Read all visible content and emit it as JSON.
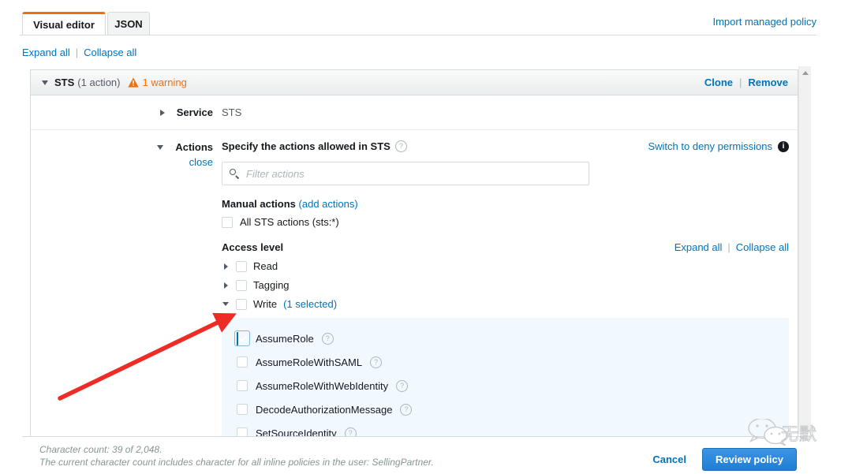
{
  "tabs": {
    "visual_editor": "Visual editor",
    "json": "JSON"
  },
  "header": {
    "import_link": "Import managed policy",
    "expand_all": "Expand all",
    "collapse_all": "Collapse all",
    "separator": "|"
  },
  "card": {
    "title": "STS",
    "count": "(1 action)",
    "warning_icon": "warning-triangle-icon",
    "warning_text": "1 warning",
    "clone": "Clone",
    "remove": "Remove",
    "separator": "|"
  },
  "service": {
    "label": "Service",
    "value": "STS"
  },
  "actions": {
    "label": "Actions",
    "close_link": "close",
    "title": "Specify the actions allowed in STS",
    "help_icon": "question-mark-icon",
    "deny_link": "Switch to deny permissions",
    "info_icon": "info-icon",
    "filter_placeholder": "Filter actions",
    "search_icon": "search-icon",
    "manual_actions_label": "Manual actions",
    "add_actions_link": "(add actions)",
    "all_actions_label": "All STS actions (sts:*)",
    "all_actions_checked": false,
    "access_level_label": "Access level",
    "expand_all": "Expand all",
    "collapse_all": "Collapse all",
    "separator": "|",
    "levels": [
      {
        "name": "Read",
        "expanded": false,
        "checked": false,
        "note": ""
      },
      {
        "name": "Tagging",
        "expanded": false,
        "checked": false,
        "note": ""
      },
      {
        "name": "Write",
        "expanded": true,
        "checked": false,
        "note": "(1 selected)"
      }
    ],
    "write_items": [
      {
        "name": "AssumeRole",
        "checked": true
      },
      {
        "name": "AssumeRoleWithSAML",
        "checked": false
      },
      {
        "name": "AssumeRoleWithWebIdentity",
        "checked": false
      },
      {
        "name": "DecodeAuthorizationMessage",
        "checked": false
      },
      {
        "name": "SetSourceIdentity",
        "checked": false
      }
    ]
  },
  "footer": {
    "note_line1": "Character count: 39 of 2,048.",
    "note_line2": "The current character count includes character for all inline policies in the user: SellingPartner.",
    "cancel": "Cancel",
    "review": "Review policy"
  },
  "annotation": {
    "arrow_color": "#ee2b24",
    "arrow_from": "76,505",
    "arrow_to": "292,401"
  },
  "watermark": {
    "text": "无默",
    "icon": "wechat-icon"
  },
  "colors": {
    "accent_orange": "#ec7211",
    "link_blue": "#0073bb",
    "primary_button": "#2f8ee0",
    "highlight_panel": "#f1f8fe"
  }
}
